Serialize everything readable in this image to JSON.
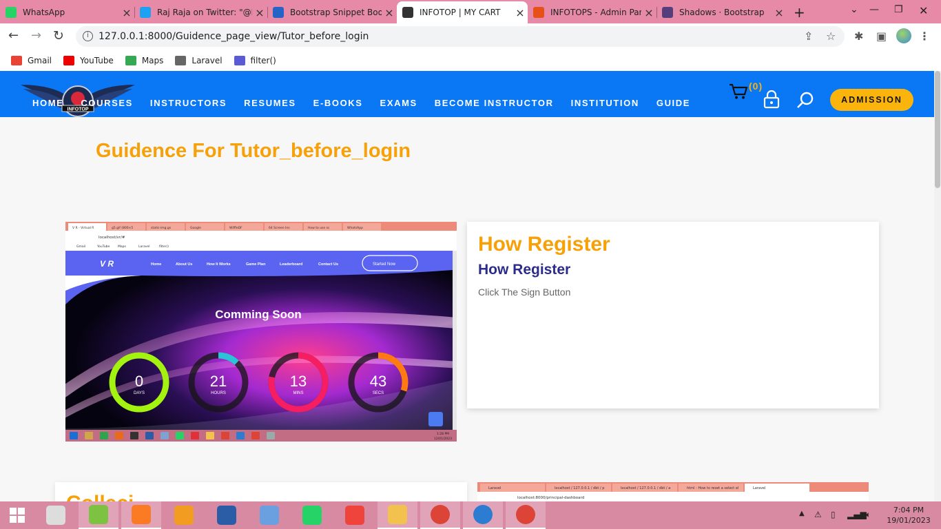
{
  "browser": {
    "tabs": [
      {
        "title": "WhatsApp",
        "icon": "whatsapp-icon",
        "color": "#25d366",
        "active": false
      },
      {
        "title": "Raj Raja on Twitter: \"@E",
        "icon": "twitter-icon",
        "color": "#1da1f2",
        "active": false
      },
      {
        "title": "Bootstrap Snippet Boot",
        "icon": "bootstrap-snippet-icon",
        "color": "#2563c6",
        "active": false
      },
      {
        "title": "INFOTOP | MY CART",
        "icon": "infotop-wing-icon",
        "color": "#333333",
        "active": true
      },
      {
        "title": "INFOTOPS - Admin Pan",
        "icon": "infotops-admin-icon",
        "color": "#e8501a",
        "active": false
      },
      {
        "title": "Shadows · Bootstrap",
        "icon": "bootstrap-b-icon",
        "color": "#563d7c",
        "active": false
      }
    ],
    "url": "127.0.0.1:8000/Guidence_page_view/Tutor_before_login",
    "bookmarks": [
      {
        "label": "Gmail",
        "icon": "gmail-icon"
      },
      {
        "label": "YouTube",
        "icon": "youtube-icon"
      },
      {
        "label": "Maps",
        "icon": "maps-icon"
      },
      {
        "label": "Laravel",
        "icon": "laravel-icon"
      },
      {
        "label": "filter()",
        "icon": "globe-icon"
      }
    ]
  },
  "site": {
    "logo_text": "INFOTOP",
    "menu": [
      "HOME",
      "COURSES",
      "INSTRUCTORS",
      "RESUMES",
      "E-BOOKS",
      "EXAMS",
      "BECOME INSTRUCTOR",
      "INSTITUTION",
      "GUIDE"
    ],
    "cart_count": "(0)",
    "admission_label": "ADMISSION",
    "page_title": "Guidence For Tutor_before_login",
    "colors": {
      "nav": "#0a77f5",
      "accent": "#fbb40b",
      "title": "#f7a008",
      "subtitle": "#2b2b8c"
    }
  },
  "guide_items": [
    {
      "heading": "How Register",
      "subheading": "How Register",
      "body": "Click The Sign Button",
      "screenshot": {
        "tabs": [
          "V R - Virtual R",
          "g5.gif (800×5",
          "static-img.gs",
          "Google",
          "WiffleDF",
          "64 Screen Ins",
          "How to use sc",
          "WhatsApp"
        ],
        "url": "localhost/vr/#",
        "bookmarks": [
          "Gmail",
          "YouTube",
          "Maps",
          "Laravel",
          "filter()"
        ],
        "brand": "V R",
        "nav": [
          "Home",
          "About Us",
          "How It Works",
          "Game Plan",
          "Leaderboard",
          "Contact Us"
        ],
        "cta": "Started Now",
        "headline": "Comming Soon",
        "countdown": [
          {
            "value": "0",
            "unit": "DAYS",
            "color": "#a4f20f",
            "fraction": 1.0
          },
          {
            "value": "21",
            "unit": "HOURS",
            "color": "#2ac4d6",
            "fraction": 0.12
          },
          {
            "value": "13",
            "unit": "MINS",
            "color": "#f51e63",
            "fraction": 0.78
          },
          {
            "value": "43",
            "unit": "SECS",
            "color": "#ff7a12",
            "fraction": 0.3
          }
        ],
        "clock_time": "1:28 PM",
        "clock_date": "12/01/2023"
      }
    },
    {
      "heading": "Colleci",
      "screenshot": {
        "tabs": [
          "Laravel",
          "localhost / 127.0.0.1 / dbt / p",
          "localhost / 127.0.0.1 / dbt / a",
          "html - How to reset a select el",
          "Laravel"
        ],
        "url": "localhost:8000/principal-dashboard"
      }
    }
  ],
  "taskbar": {
    "apps": [
      {
        "name": "windows-start-icon",
        "running": false
      },
      {
        "name": "snipping-tool-icon",
        "running": false
      },
      {
        "name": "notepad-plus-icon",
        "running": true
      },
      {
        "name": "xampp-icon",
        "running": true
      },
      {
        "name": "sublime-text-icon",
        "running": false
      },
      {
        "name": "word-icon",
        "running": false
      },
      {
        "name": "window-manager-icon",
        "running": false
      },
      {
        "name": "whatsapp-app-icon",
        "running": false
      },
      {
        "name": "anydesk-icon",
        "running": false
      },
      {
        "name": "file-explorer-icon",
        "running": true
      },
      {
        "name": "chrome-icon",
        "running": true
      },
      {
        "name": "vscode-icon",
        "running": true
      },
      {
        "name": "chrome-icon-2",
        "running": true
      }
    ],
    "time": "7:04 PM",
    "date": "19/01/2023"
  }
}
